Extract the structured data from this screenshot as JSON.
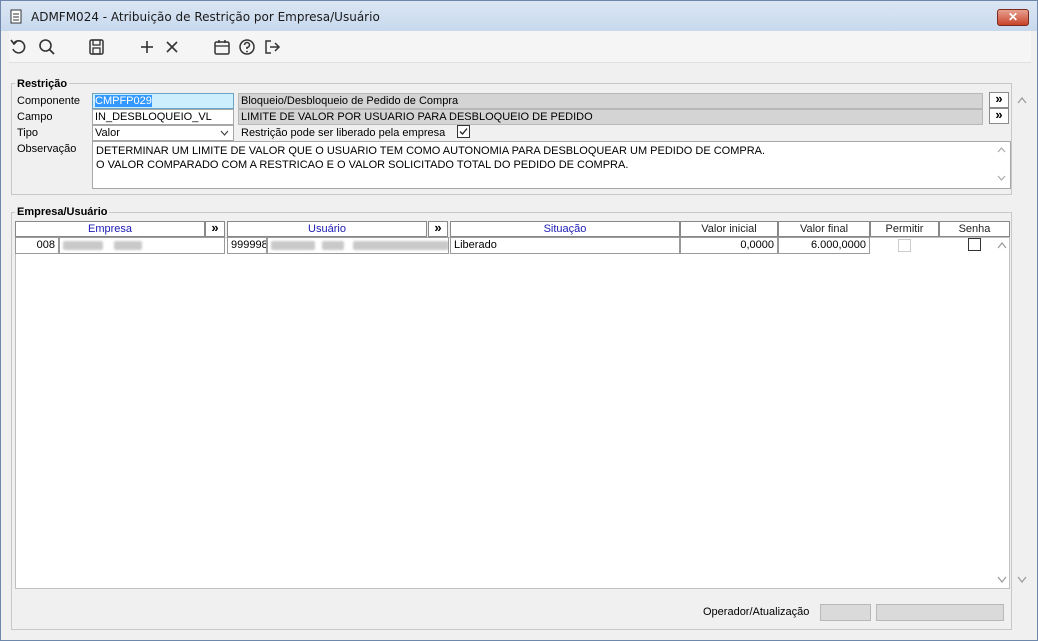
{
  "window": {
    "title": "ADMFM024 - Atribuição de Restrição por Empresa/Usuário",
    "close_label": "✕"
  },
  "toolbar": {
    "buttons": [
      "undo-icon",
      "search-icon",
      "save-icon",
      "add-icon",
      "delete-icon",
      "calendar-icon",
      "help-icon",
      "exit-icon"
    ]
  },
  "restricao": {
    "group_title": "Restrição",
    "componente_label": "Componente",
    "componente_value": "CMPFP029",
    "componente_desc": "Bloqueio/Desbloqueio de Pedido de Compra",
    "campo_label": "Campo",
    "campo_value": "IN_DESBLOQUEIO_VL",
    "campo_desc": "LIMITE DE VALOR POR USUARIO PARA DESBLOQUEIO DE PEDIDO",
    "tipo_label": "Tipo",
    "tipo_value": "Valor",
    "liberado_label": "Restrição pode ser liberado pela empresa",
    "liberado_checked": true,
    "observacao_label": "Observação",
    "observacao_lines": [
      "DETERMINAR UM LIMITE DE VALOR QUE O USUARIO TEM COMO AUTONOMIA PARA DESBLOQUEAR UM PEDIDO DE COMPRA.",
      "O VALOR COMPARADO COM A RESTRICAO E O VALOR SOLICITADO TOTAL DO PEDIDO DE COMPRA."
    ],
    "more_label": "»"
  },
  "empresa_usuario": {
    "group_title": "Empresa/Usuário",
    "columns": {
      "empresa": "Empresa",
      "usuario": "Usuário",
      "situacao": "Situação",
      "valor_inicial": "Valor inicial",
      "valor_final": "Valor final",
      "permitir": "Permitir",
      "senha": "Senha"
    },
    "more_label": "»",
    "rows": [
      {
        "empresa_code": "008",
        "usuario_code": "999998",
        "situacao": "Liberado",
        "valor_inicial": "0,0000",
        "valor_final": "6.000,0000",
        "permitir": false,
        "senha": false
      }
    ]
  },
  "status": {
    "operador_label": "Operador/Atualização"
  }
}
